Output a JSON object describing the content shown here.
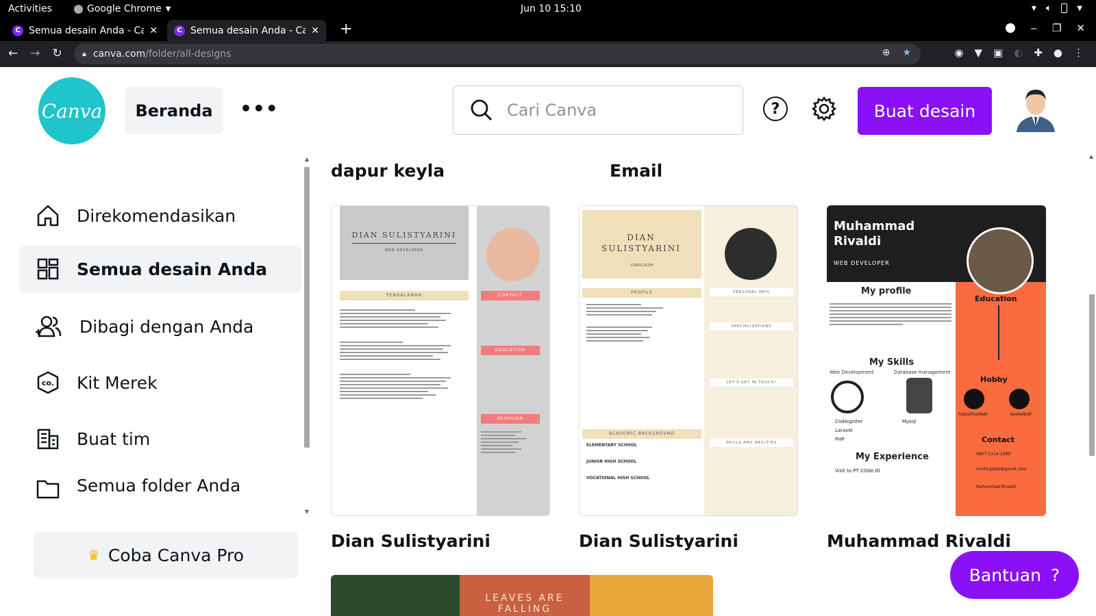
{
  "system_bar": {
    "activities": "Activities",
    "app_name": "Google Chrome",
    "clock": "Jun 10  15:10"
  },
  "browser": {
    "tabs": [
      {
        "title": "Semua desain Anda - Canva",
        "active": false
      },
      {
        "title": "Semua desain Anda - Canva",
        "active": true
      }
    ],
    "url_host": "canva.com",
    "url_path": "/folder/all-designs"
  },
  "header": {
    "logo_text": "Canva",
    "home_label": "Beranda",
    "more_label": "•••",
    "search_placeholder": "Cari Canva",
    "help_label": "?",
    "create_label": "Buat desain"
  },
  "sidebar": {
    "items": [
      {
        "label": "Direkomendasikan",
        "icon": "home-icon",
        "active": false
      },
      {
        "label": "Semua desain Anda",
        "icon": "grid-icon",
        "active": true
      },
      {
        "label": "Dibagi dengan Anda",
        "icon": "people-icon",
        "active": false
      },
      {
        "label": "Kit Merek",
        "icon": "brand-kit-icon",
        "active": false
      },
      {
        "label": "Buat tim",
        "icon": "team-icon",
        "active": false
      },
      {
        "label": "Semua folder Anda",
        "icon": "folder-icon",
        "active": false
      }
    ],
    "pro_label": "Coba Canva Pro"
  },
  "main": {
    "folders": [
      "dapur keyla",
      "Email"
    ],
    "designs": [
      {
        "title": "Dian Sulistyarini",
        "thumb": {
          "name": "DIAN SULISTYARINI",
          "role": "WEB DEVELOPER",
          "left_header": "PENGALAMAN",
          "right_headers": [
            "CONTACT",
            "EDUCATION",
            "KEAHLIAN"
          ]
        }
      },
      {
        "title": "Dian Sulistyarini",
        "thumb": {
          "name": "DIAN SULISTYARINI",
          "role": "CURRICULUM",
          "left_headers": [
            "PROFILE",
            "ACADEMIC BACKGROUND"
          ],
          "right_headers": [
            "PERSONAL INFO",
            "SPECIALIZATIONS",
            "LET'S GET IN TOUCH!",
            "SKILLS AND ABILITIES"
          ],
          "school_lines": [
            "ELEMENTARY SCHOOL",
            "JUNIOR HIGH SCHOOL",
            "VOCATIONAL HIGH SCHOOL"
          ]
        }
      },
      {
        "title": "Muhammad Rivaldi",
        "thumb": {
          "name": "Muhammad Rivaldi",
          "role": "WEB DEVELOPER",
          "sections": [
            "My profile",
            "My Skills",
            "My Experience",
            "Education",
            "Hobby",
            "Contact"
          ],
          "skills": [
            "Web Development",
            "Database management"
          ],
          "skill_items": [
            "Codeigniter",
            "Laravel",
            "PHP",
            "Mysql"
          ],
          "experience": "Visit to PT COde.ID",
          "hobbies": [
            "Futsal/football",
            "basketball"
          ],
          "contact": [
            "0857-1114-2389",
            "mrvld.paldo@gmail.com",
            "Muhammad-Rivaldi"
          ]
        }
      }
    ],
    "bottom_thumb_text": "LEAVES ARE FALLING"
  },
  "help_fab": {
    "label": "Bantuan",
    "icon_label": "?"
  },
  "colors": {
    "brand_teal": "#20c4cb",
    "brand_purple": "#8b10f5",
    "rivaldi_orange": "#ff6b3d"
  }
}
